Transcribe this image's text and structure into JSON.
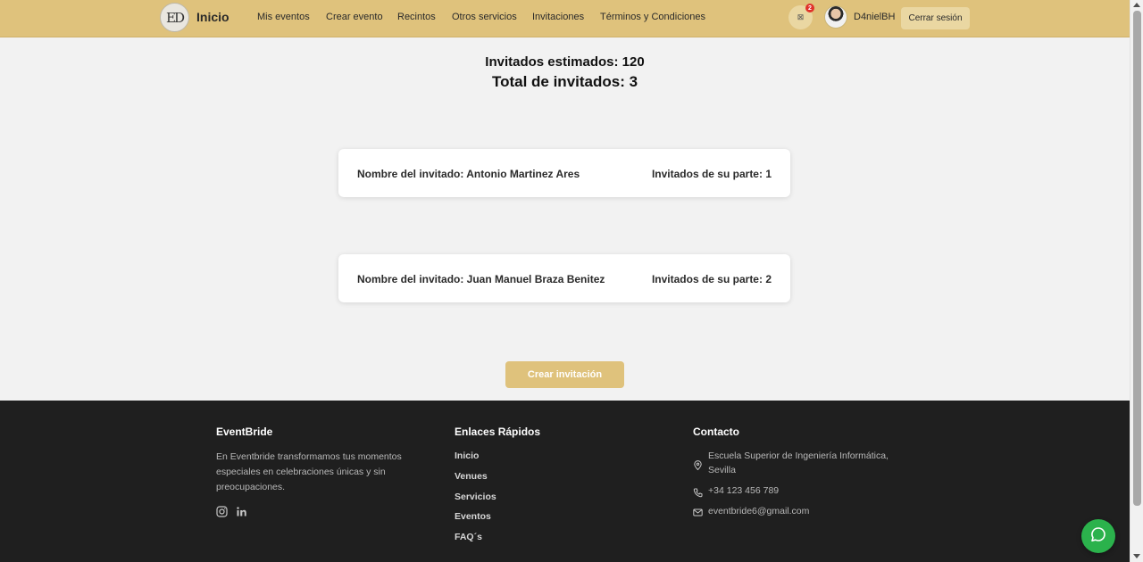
{
  "nav": {
    "brand": "Inicio",
    "logo_text": "ED",
    "links": [
      "Mis eventos",
      "Crear evento",
      "Recintos",
      "Otros servicios",
      "Invitaciones",
      "Términos y Condiciones"
    ],
    "messages_icon": "⊠",
    "message_badge": "2",
    "username": "D4nielBH",
    "logout_label": "Cerrar sesión"
  },
  "summary": {
    "estimated": "Invitados estimados: 120",
    "total": "Total de invitados: 3"
  },
  "guests": [
    {
      "name": "Nombre del invitado: Antonio Martinez Ares",
      "companions": "Invitados de su parte: 1"
    },
    {
      "name": "Nombre del invitado: Juan Manuel Braza Benitez",
      "companions": "Invitados de su parte: 2"
    }
  ],
  "create_button": "Crear invitación",
  "footer": {
    "brand_title": "EventBride",
    "brand_description": "En Eventbride transformamos tus momentos especiales en celebraciones únicas y sin preocupaciones.",
    "social_icons": [
      "instagram-icon",
      "linkedin-icon"
    ],
    "links_title": "Enlaces Rápidos",
    "links": [
      "Inicio",
      "Venues",
      "Servicios",
      "Eventos",
      "FAQ´s"
    ],
    "contact_title": "Contacto",
    "address": "Escuela Superior de Ingeniería Informática, Sevilla",
    "phone": "+34 123 456 789",
    "email": "eventbride6@gmail.com"
  },
  "colors": {
    "accent": "#dfc27c",
    "footer_bg": "#1f1f1f",
    "chat_button": "#2bb24c",
    "badge": "#e0312a"
  }
}
